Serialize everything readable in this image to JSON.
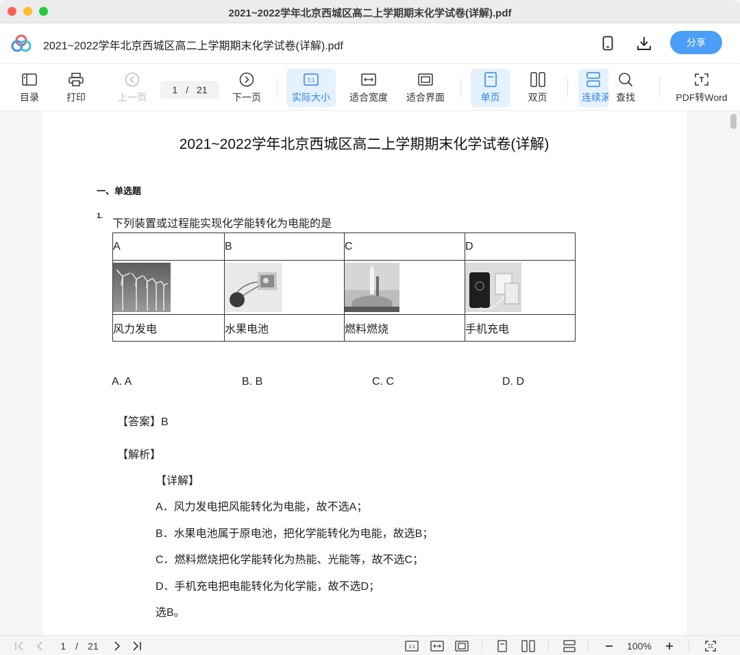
{
  "window": {
    "title": "2021~2022学年北京西城区高二上学期期末化学试卷(详解).pdf"
  },
  "header": {
    "doc_name": "2021~2022学年北京西城区高二上学期期末化学试卷(详解).pdf",
    "share_label": "分享",
    "icons": [
      "app-logo",
      "phone-icon",
      "download-icon"
    ]
  },
  "toolbar": {
    "toc": "目录",
    "print": "打印",
    "prev": "上一页",
    "page_current": "1",
    "page_sep": "/",
    "page_total": "21",
    "next": "下一页",
    "actual_size": "实际大小",
    "fit_width": "适合宽度",
    "fit_page": "适合界面",
    "single": "单页",
    "double": "双页",
    "continuous": "连续滚",
    "find": "查找",
    "pdf_to_word": "PDF转Word"
  },
  "document": {
    "title": "2021~2022学年北京西城区高二上学期期末化学试卷(详解)",
    "section": "一、单选题",
    "q_number": "1.",
    "question": "下列装置或过程能实现化学能转化为电能的是",
    "table": {
      "headers": [
        "A",
        "B",
        "C",
        "D"
      ],
      "images": [
        "wind-turbines-image",
        "fruit-battery-image",
        "rocket-launch-image",
        "phone-charging-image"
      ],
      "labels": [
        "风力发电",
        "水果电池",
        "燃料燃烧",
        "手机充电"
      ]
    },
    "options": [
      "A. A",
      "B. B",
      "C. C",
      "D. D"
    ],
    "answer": "【答案】B",
    "analysis": "【解析】",
    "detail": "【详解】",
    "explanations": [
      "A．风力发电把风能转化为电能，故不选A；",
      "B．水果电池属于原电池，把化学能转化为电能，故选B；",
      "C．燃料燃烧把化学能转化为热能、光能等，故不选C；",
      "D．手机充电把电能转化为化学能，故不选D；",
      "选B。"
    ]
  },
  "statusbar": {
    "page_current": "1",
    "page_sep": "/",
    "page_total": "21",
    "zoom": "100%"
  },
  "colors": {
    "accent": "#4b9ef5",
    "active_bg": "#e5f1fd",
    "active_text": "#2f86e8"
  }
}
